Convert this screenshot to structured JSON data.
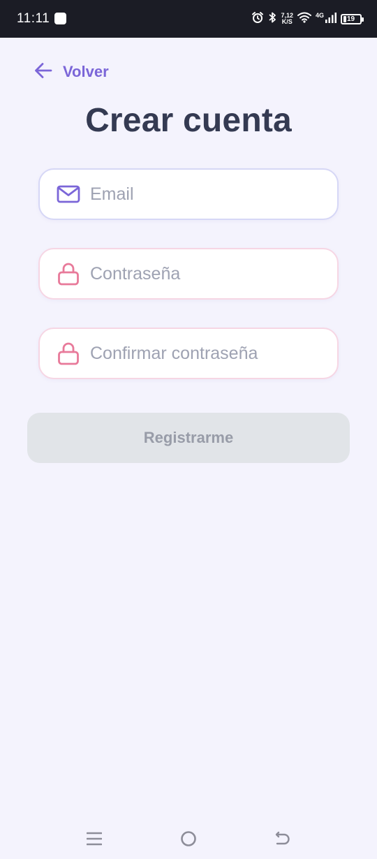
{
  "status_bar": {
    "time": "11:11",
    "net_speed_value": "7,12",
    "net_speed_unit": "K/S",
    "network_type": "4G",
    "battery_level": "19"
  },
  "header": {
    "back_label": "Volver",
    "title": "Crear cuenta"
  },
  "form": {
    "email_placeholder": "Email",
    "email_value": "",
    "password_placeholder": "Contraseña",
    "password_value": "",
    "confirm_placeholder": "Confirmar contraseña",
    "confirm_value": "",
    "submit_label": "Registrarme"
  },
  "colors": {
    "background": "#f4f3fd",
    "accent_purple": "#7b66d8",
    "accent_pink": "#e87a9a",
    "title_text": "#343a52",
    "button_disabled_bg": "#e1e4e8",
    "button_disabled_text": "#989ca8"
  },
  "icons": {
    "back": "arrow-left-icon",
    "email": "mail-icon",
    "password": "lock-icon",
    "confirm": "lock-icon",
    "nav_menu": "menu-icon",
    "nav_home": "home-circle-icon",
    "nav_back": "back-icon"
  }
}
